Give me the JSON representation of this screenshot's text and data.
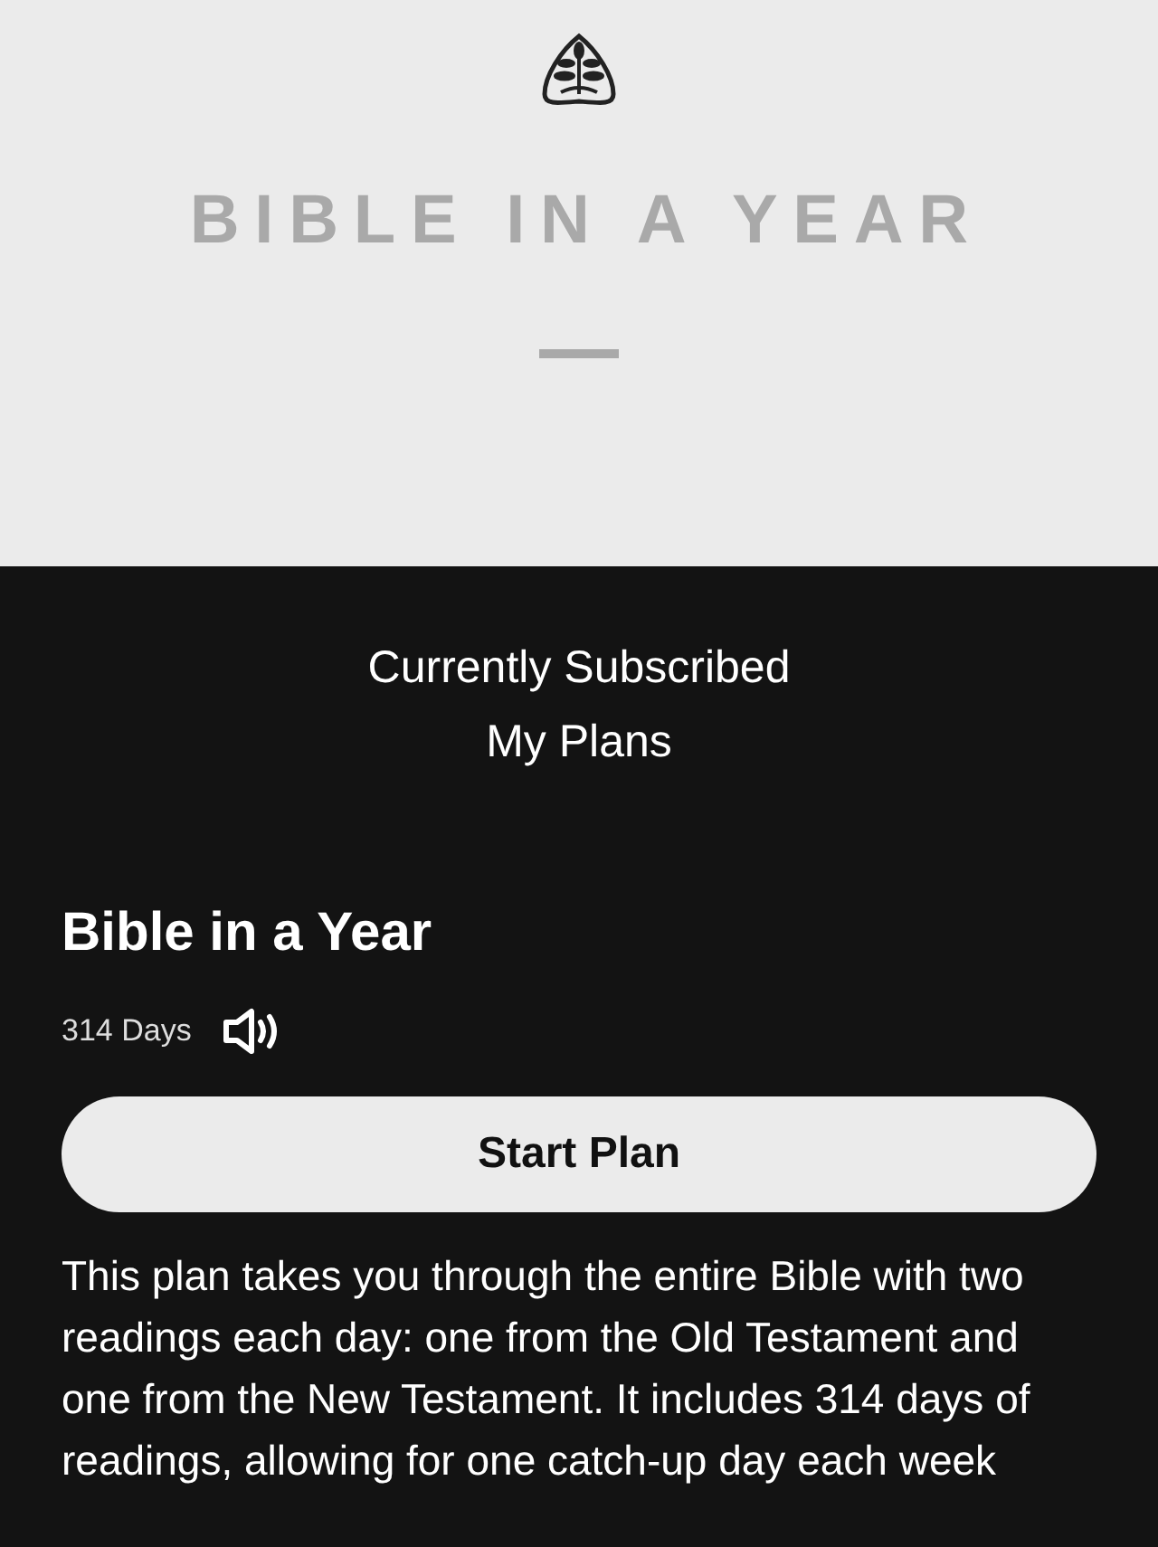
{
  "cover": {
    "title": "BIBLE IN A YEAR"
  },
  "subscription": {
    "status": "Currently Subscribed",
    "link": "My Plans"
  },
  "plan": {
    "title": "Bible in a Year",
    "duration": "314 Days",
    "button": "Start Plan",
    "description": "This plan takes you through the entire Bible with two readings each day: one from the Old Testament and one from the New Testament. It includes 314 days of readings, allowing for one catch-up day each week"
  }
}
